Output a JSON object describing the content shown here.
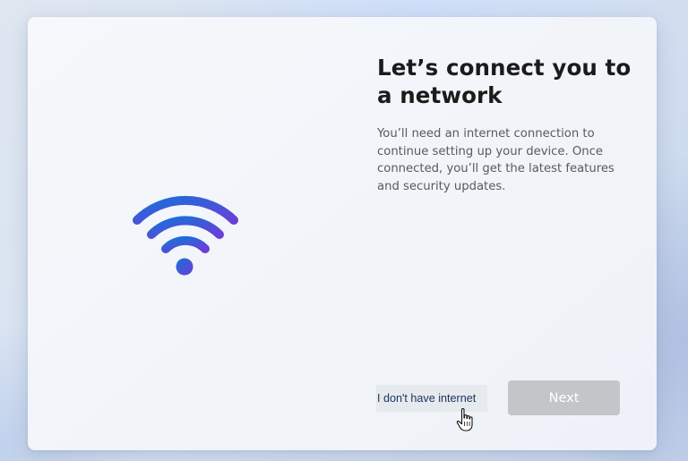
{
  "setup": {
    "title": "Let’s connect you to a network",
    "description": "You’ll need an internet connection to continue setting up your device. Once connected, you’ll get the latest features and security updates.",
    "no_internet_label": "I don't have internet",
    "next_label": "Next",
    "next_enabled": false
  },
  "icons": {
    "illustration": "wifi-icon",
    "pointer": "hand-pointer-icon"
  },
  "colors": {
    "wifi_gradient_start": "#1a6fd9",
    "wifi_gradient_end": "#6a3fd8",
    "next_disabled_bg": "#c3c5c9",
    "link_text": "#16355c"
  }
}
